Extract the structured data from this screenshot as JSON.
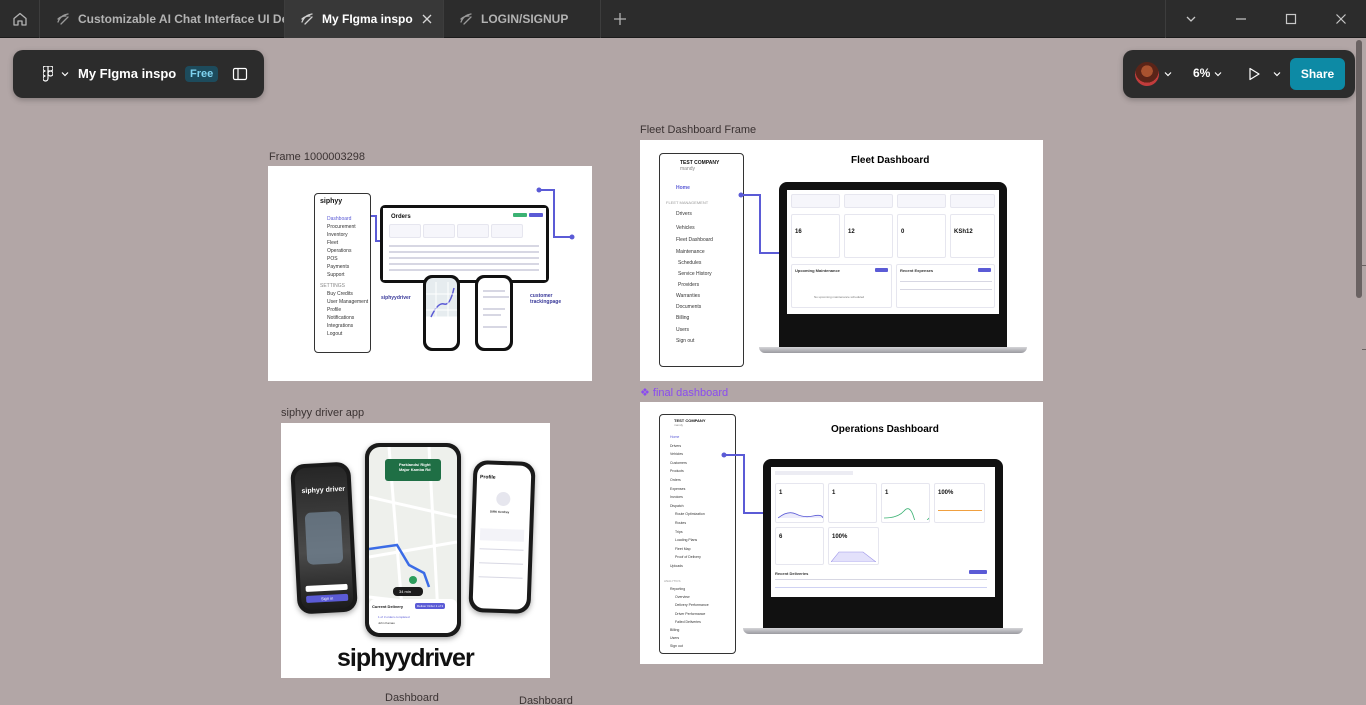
{
  "window": {
    "tabs": [
      {
        "label": "Customizable AI Chat Interface UI De"
      },
      {
        "label": "My FIgma inspo"
      },
      {
        "label": "LOGIN/SIGNUP"
      }
    ]
  },
  "file_panel": {
    "file_name": "My FIgma inspo",
    "plan_badge": "Free"
  },
  "share_panel": {
    "zoom": "6%",
    "share_label": "Share"
  },
  "canvas": {
    "frames": {
      "frame_1000003298": {
        "label": "Frame 1000003298",
        "brand": "siphyy",
        "sidebar_items": [
          "Dashboard",
          "Procurement",
          "Inventory",
          "Fleet",
          "Operations",
          "POS",
          "Payments",
          "Support"
        ],
        "settings_heading": "SETTINGS",
        "settings_items": [
          "Buy Credits",
          "User Management",
          "Profile",
          "Notifications",
          "Integrations",
          "Logout"
        ],
        "orders_title": "Orders",
        "driver_caption": "siphyydriver",
        "customer_caption": "customer trackingpage"
      },
      "fleet_dashboard": {
        "label": "Fleet Dashboard Frame",
        "title": "Fleet Dashboard",
        "company": "TEST COMPANY",
        "company_sub": "mandy",
        "nav_home": "Home",
        "nav_heading": "FLEET MANAGEMENT",
        "nav_items": [
          "Drivers",
          "Vehicles",
          "Fleet Dashboard",
          "Maintenance",
          "Schedules",
          "Service History",
          "Providers",
          "Warranties",
          "Documents",
          "Billing",
          "Users",
          "Sign out"
        ],
        "stat_labels": [
          "Total Vehicles",
          "Total Drivers",
          "Scheduled Maintenance",
          "Total Expenses"
        ],
        "stat_values": [
          "16",
          "12",
          "0",
          "KSh12"
        ],
        "section_maintenance": "Upcoming Maintenance",
        "section_expenses": "Recent Expenses",
        "empty_note": "No upcoming maintenance scheduled"
      },
      "final_dashboard": {
        "label": "final dashboard",
        "title": "Operations Dashboard",
        "company": "TEST COMPANY",
        "company_sub": "mandy",
        "nav_items": [
          "Home",
          "Drivers",
          "Vehicles",
          "Customers",
          "Products",
          "Orders",
          "Expenses",
          "Invoices",
          "Dispatch",
          "Route Optimization",
          "Routes",
          "Trips",
          "Loading Plans",
          "Fleet Map",
          "Proof of Delivery",
          "Uploads"
        ],
        "analytics_heading": "ANALYTICS",
        "analytics_items": [
          "Reporting",
          "Overview",
          "Delivery Performance",
          "Driver Performance",
          "Failed Deliveries",
          "Billing",
          "Users",
          "Sign out"
        ],
        "stat_values": [
          "1",
          "1",
          "1",
          "100%",
          "6",
          "100%"
        ],
        "section_recent": "Recent Deliveries"
      },
      "driver_app": {
        "label": "siphyy driver app",
        "splash_brand": "siphyy driver",
        "splash_signin": "Sign in",
        "nav_banner": "Parklands/ Right Major Kamba Rd",
        "eta_time": "34 min",
        "current_delivery": "Current Delivery",
        "deliver_button": "Deliver Order 1 of 3",
        "progress_note": "1 of 3 orders completed",
        "customer_name": "John Kamau",
        "profile_title": "Profile",
        "driver_name": "DIRK Kenfrey",
        "brand_footer": "siphyydriver"
      }
    },
    "bottom_labels": [
      "Dashboard",
      "Dashboard"
    ]
  },
  "colors": {
    "canvas": "#b2a6a6",
    "chrome": "#2c2c2c",
    "share": "#0d8aa5",
    "accent": "#5b5bd6",
    "component_label": "#8a4bf0"
  }
}
